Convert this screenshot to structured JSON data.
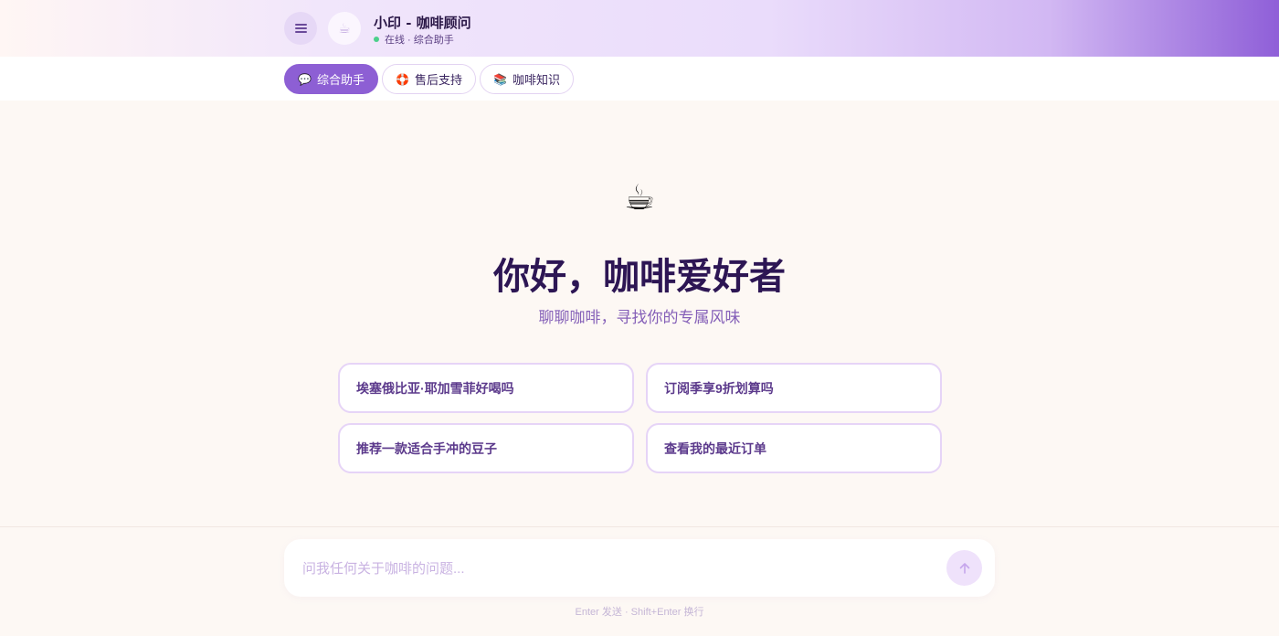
{
  "header": {
    "title": "小印 - 咖啡顾问",
    "status": "在线 · 综合助手",
    "status_color": "#4cd08b",
    "menu_icon": "hamburger-menu-icon",
    "logo_icon": "coffee-cup-icon"
  },
  "tabs": [
    {
      "label": "综合助手",
      "icon": "💬",
      "active": true
    },
    {
      "label": "售后支持",
      "icon": "🛟",
      "active": false
    },
    {
      "label": "咖啡知识",
      "icon": "📚",
      "active": false
    }
  ],
  "hero": {
    "icon": "☕",
    "heading": "你好，咖啡爱好者",
    "subheading": "聊聊咖啡，寻找你的专属风味"
  },
  "suggestions": [
    "埃塞俄比亚·耶加雪菲好喝吗",
    "订阅季享9折划算吗",
    "推荐一款适合手冲的豆子",
    "查看我的最近订单"
  ],
  "composer": {
    "placeholder": "问我任何关于咖啡的问题...",
    "send_icon": "arrow-up-icon",
    "hint": "Enter 发送 · Shift+Enter 换行"
  },
  "colors": {
    "accent": "#8d5fd4",
    "heading": "#2d1654",
    "background": "#fdf8f4"
  }
}
